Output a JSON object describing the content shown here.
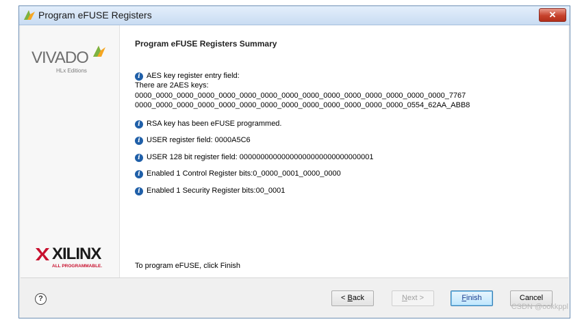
{
  "window": {
    "title": "Program eFUSE Registers",
    "close_glyph": "✕"
  },
  "branding": {
    "vivado_word": "VIVADO",
    "vivado_sub": "HLx Editions",
    "xilinx_word": "XILINX",
    "xilinx_sub": "ALL PROGRAMMABLE."
  },
  "summary": {
    "title": "Program eFUSE Registers Summary",
    "aes": {
      "label": "AES key register entry field:",
      "count_line": "There are 2AES keys:",
      "key1": "0000_0000_0000_0000_0000_0000_0000_0000_0000_0000_0000_0000_0000_0000_0000_7767",
      "key2": "0000_0000_0000_0000_0000_0000_0000_0000_0000_0000_0000_0000_0000_0554_62AA_ABB8"
    },
    "rsa": "RSA key has been eFUSE programmed.",
    "user": "USER register field: 0000A5C6",
    "user128": "USER 128 bit register field: 00000000000000000000000000000001",
    "control": "Enabled 1 Control Register bits:0_0000_0001_0000_0000",
    "security": "Enabled 1 Security Register bits:00_0001",
    "finish_hint": "To program eFUSE, click Finish"
  },
  "footer": {
    "help_glyph": "?",
    "back_prefix": "< ",
    "back_key": "B",
    "back_rest": "ack",
    "next_key": "N",
    "next_rest": "ext >",
    "finish_key": "F",
    "finish_rest": "inish",
    "cancel": "Cancel"
  },
  "watermark": "CSDN @ookkppl",
  "colors": {
    "info_icon": "#1f5fa8",
    "vivado_accent": "#f5a623",
    "xilinx_red": "#c8102e"
  }
}
